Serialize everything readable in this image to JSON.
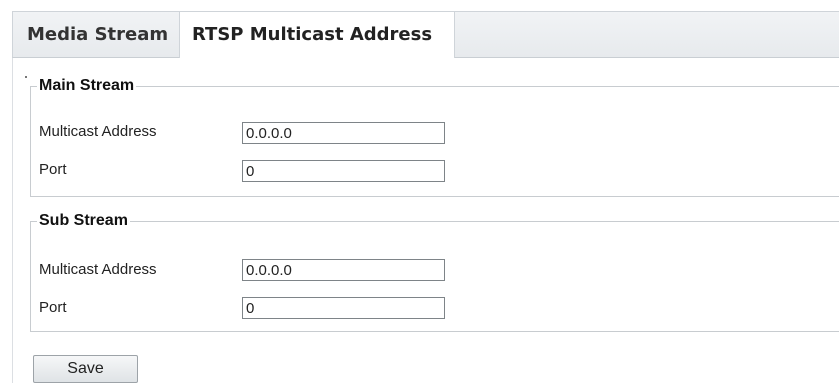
{
  "tabs": {
    "media_stream": "Media Stream",
    "rtsp_multicast_address": "RTSP Multicast Address"
  },
  "active_tab": "RTSP Multicast Address",
  "main_stream": {
    "title": "Main Stream",
    "multicast_address_label": "Multicast Address",
    "multicast_address_value": "0.0.0.0",
    "port_label": "Port",
    "port_value": "0"
  },
  "sub_stream": {
    "title": "Sub Stream",
    "multicast_address_label": "Multicast Address",
    "multicast_address_value": "0.0.0.0",
    "port_label": "Port",
    "port_value": "0"
  },
  "actions": {
    "save_label": "Save"
  },
  "colors": {
    "tabbar_background": "#e9ecef",
    "active_tab_background": "#ffffff",
    "border": "#c8ccd0"
  }
}
